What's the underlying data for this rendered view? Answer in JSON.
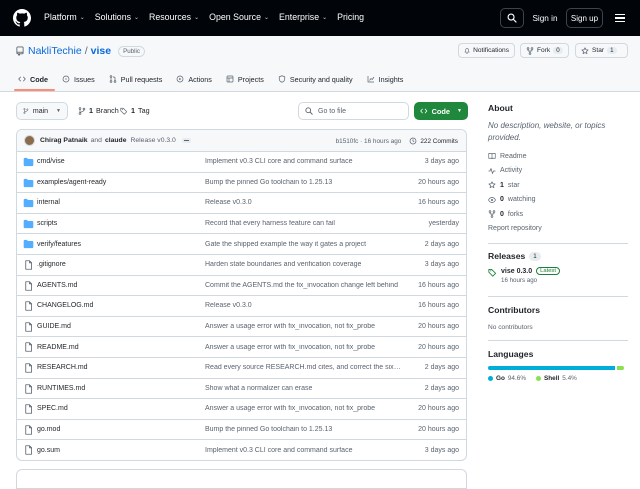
{
  "topbar": {
    "nav": [
      {
        "label": "Platform",
        "has_menu": true
      },
      {
        "label": "Solutions",
        "has_menu": true
      },
      {
        "label": "Resources",
        "has_menu": true
      },
      {
        "label": "Open Source",
        "has_menu": true
      },
      {
        "label": "Enterprise",
        "has_menu": true
      },
      {
        "label": "Pricing",
        "has_menu": false
      }
    ],
    "sign_in": "Sign in",
    "sign_up": "Sign up"
  },
  "repo": {
    "owner": "NakliTechie",
    "separator": "/",
    "name": "vise",
    "visibility": "Public",
    "notifications_label": "Notifications",
    "fork_label": "Fork",
    "fork_count": "0",
    "star_label": "Star",
    "star_count": "1"
  },
  "tabs": [
    {
      "label": "Code",
      "icon": "code-icon",
      "active": true
    },
    {
      "label": "Issues",
      "icon": "issue-icon",
      "active": false
    },
    {
      "label": "Pull requests",
      "icon": "pull-request-icon",
      "active": false
    },
    {
      "label": "Actions",
      "icon": "play-icon",
      "active": false
    },
    {
      "label": "Projects",
      "icon": "table-icon",
      "active": false
    },
    {
      "label": "Security and quality",
      "icon": "shield-icon",
      "active": false
    },
    {
      "label": "Insights",
      "icon": "graph-icon",
      "active": false
    }
  ],
  "toolbar": {
    "branch": "main",
    "branch_count": "1",
    "branch_word": "Branch",
    "tag_count": "1",
    "tag_word": "Tag",
    "goto_placeholder": "Go to file",
    "code_label": "Code"
  },
  "latest_commit": {
    "author1": "Chirag Patnaik",
    "and": "and",
    "author2": "claude",
    "message": "Release v0.3.0",
    "sha": "b1510fc",
    "age": "16 hours ago",
    "commit_count": "222 Commits"
  },
  "files": [
    {
      "type": "dir",
      "name": "cmd/vise",
      "message": "Implement v0.3 CLI core and command surface",
      "age": "3 days ago"
    },
    {
      "type": "dir",
      "name": "examples/agent-ready",
      "message": "Bump the pinned Go toolchain to 1.25.13",
      "age": "20 hours ago"
    },
    {
      "type": "dir",
      "name": "internal",
      "message": "Release v0.3.0",
      "age": "16 hours ago"
    },
    {
      "type": "dir",
      "name": "scripts",
      "message": "Record that every harness feature can fail",
      "age": "yesterday"
    },
    {
      "type": "dir",
      "name": "verify/features",
      "message": "Gate the shipped example the way it gates a project",
      "age": "2 days ago"
    },
    {
      "type": "file",
      "name": ".gitignore",
      "message": "Harden state boundaries and verification coverage",
      "age": "3 days ago"
    },
    {
      "type": "file",
      "name": "AGENTS.md",
      "message": "Commit the AGENTS.md the fix_invocation change left behind",
      "age": "16 hours ago"
    },
    {
      "type": "file",
      "name": "CHANGELOG.md",
      "message": "Release v0.3.0",
      "age": "16 hours ago"
    },
    {
      "type": "file",
      "name": "GUIDE.md",
      "message": "Answer a usage error with fix_invocation, not fix_probe",
      "age": "20 hours ago"
    },
    {
      "type": "file",
      "name": "README.md",
      "message": "Answer a usage error with fix_invocation, not fix_probe",
      "age": "20 hours ago"
    },
    {
      "type": "file",
      "name": "RESEARCH.md",
      "message": "Read every source RESEARCH.md cites, and correct the six claims i...",
      "age": "2 days ago"
    },
    {
      "type": "file",
      "name": "RUNTIMES.md",
      "message": "Show what a normalizer can erase",
      "age": "2 days ago"
    },
    {
      "type": "file",
      "name": "SPEC.md",
      "message": "Answer a usage error with fix_invocation, not fix_probe",
      "age": "20 hours ago"
    },
    {
      "type": "file",
      "name": "go.mod",
      "message": "Bump the pinned Go toolchain to 1.25.13",
      "age": "20 hours ago"
    },
    {
      "type": "file",
      "name": "go.sum",
      "message": "Implement v0.3 CLI core and command surface",
      "age": "3 days ago"
    }
  ],
  "about": {
    "heading": "About",
    "description": "No description, website, or topics provided.",
    "readme": "Readme",
    "activity": "Activity",
    "stars_count": "1",
    "stars_word": "star",
    "watching_count": "0",
    "watching_word": "watching",
    "forks_count": "0",
    "forks_word": "forks",
    "report": "Report repository"
  },
  "releases": {
    "heading": "Releases",
    "count": "1",
    "tag": "vise 0.3.0",
    "badge": "Latest",
    "age": "16 hours ago"
  },
  "contributors": {
    "heading": "Contributors",
    "empty": "No contributors"
  },
  "languages": {
    "heading": "Languages",
    "items": [
      {
        "name": "Go",
        "percent": "94.6%",
        "value": 94.6,
        "color": "#00ADD8"
      },
      {
        "name": "Shell",
        "percent": "5.4%",
        "value": 5.4,
        "color": "#89e051"
      }
    ]
  },
  "colors": {
    "topbar_bg": "#010409",
    "link": "#0969da",
    "code_button": "#1f883d",
    "tab_underline": "#fd8c73",
    "folder": "#54aeff"
  }
}
